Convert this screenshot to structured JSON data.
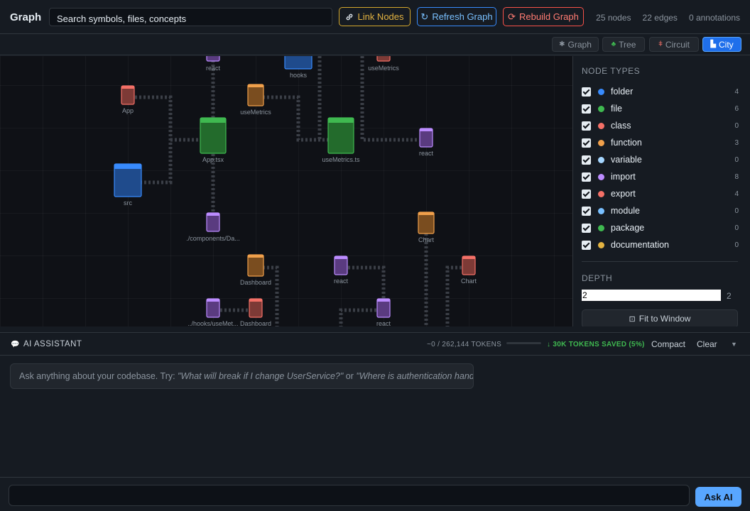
{
  "header": {
    "title": "Graph",
    "search_value": "Search symbols, files, concepts",
    "buttons": {
      "link": "Link Nodes",
      "refresh": "Refresh Graph",
      "rebuild": "Rebuild Graph"
    },
    "stats": {
      "nodes": "25 nodes",
      "edges": "22 edges",
      "annotations": "0 annotations"
    }
  },
  "views": [
    {
      "label": "Graph",
      "icon": "graph-icon",
      "active": false
    },
    {
      "label": "Tree",
      "icon": "tree-icon",
      "active": false
    },
    {
      "label": "Circuit",
      "icon": "circuit-icon",
      "active": false
    },
    {
      "label": "City",
      "icon": "city-icon",
      "active": true
    }
  ],
  "graph": {
    "nodes": [
      {
        "label": "react",
        "kind": "import"
      },
      {
        "label": "hooks",
        "kind": "folder"
      },
      {
        "label": "useMetrics",
        "kind": "class"
      },
      {
        "label": "App",
        "kind": "class"
      },
      {
        "label": "useMetrics",
        "kind": "function"
      },
      {
        "label": "App.tsx",
        "kind": "file"
      },
      {
        "label": "useMetrics.ts",
        "kind": "file"
      },
      {
        "label": "react",
        "kind": "import"
      },
      {
        "label": "src",
        "kind": "folder"
      },
      {
        "label": "./components/Da...",
        "kind": "import"
      },
      {
        "label": "Chart",
        "kind": "function"
      },
      {
        "label": "Dashboard",
        "kind": "function"
      },
      {
        "label": "react",
        "kind": "import"
      },
      {
        "label": "Chart",
        "kind": "class"
      },
      {
        "label": "../hooks/useMet...",
        "kind": "import"
      },
      {
        "label": "Dashboard",
        "kind": "class"
      },
      {
        "label": "react",
        "kind": "import"
      }
    ],
    "colors": {
      "folder": "#388bfd",
      "file": "#3fb950",
      "class": "#f47067",
      "function": "#f0a04b",
      "import": "#bc8cff",
      "edge": "#3b3f47"
    }
  },
  "sidebar": {
    "node_types_title": "NODE TYPES",
    "node_types": [
      {
        "label": "folder",
        "count": "4",
        "color": "#388bfd",
        "checked": true
      },
      {
        "label": "file",
        "count": "6",
        "color": "#3fb950",
        "checked": true
      },
      {
        "label": "class",
        "count": "0",
        "color": "#f47067",
        "checked": true
      },
      {
        "label": "function",
        "count": "3",
        "color": "#f0a04b",
        "checked": true
      },
      {
        "label": "variable",
        "count": "0",
        "color": "#a5d6ff",
        "checked": true
      },
      {
        "label": "import",
        "count": "8",
        "color": "#bc8cff",
        "checked": true
      },
      {
        "label": "export",
        "count": "4",
        "color": "#f47067",
        "checked": true
      },
      {
        "label": "module",
        "count": "0",
        "color": "#79c0ff",
        "checked": true
      },
      {
        "label": "package",
        "count": "0",
        "color": "#3fb950",
        "checked": true
      },
      {
        "label": "documentation",
        "count": "0",
        "color": "#e3b341",
        "checked": true
      }
    ],
    "depth_title": "DEPTH",
    "depth_value": "2",
    "depth_display": "2",
    "fit_label": "Fit to Window"
  },
  "ai": {
    "title": "AI ASSISTANT",
    "tokens": "~0 / 262,144 TOKENS",
    "saved": "↓ 30K TOKENS SAVED (5%)",
    "compact": "Compact",
    "clear": "Clear",
    "hint_prefix": "Ask anything about your codebase. Try: ",
    "hint_q1": "\"What will break if I change UserService?\"",
    "hint_or": " or ",
    "hint_q2": "\"Where is authentication handled?\"",
    "input_value": "",
    "ask_label": "Ask AI"
  }
}
